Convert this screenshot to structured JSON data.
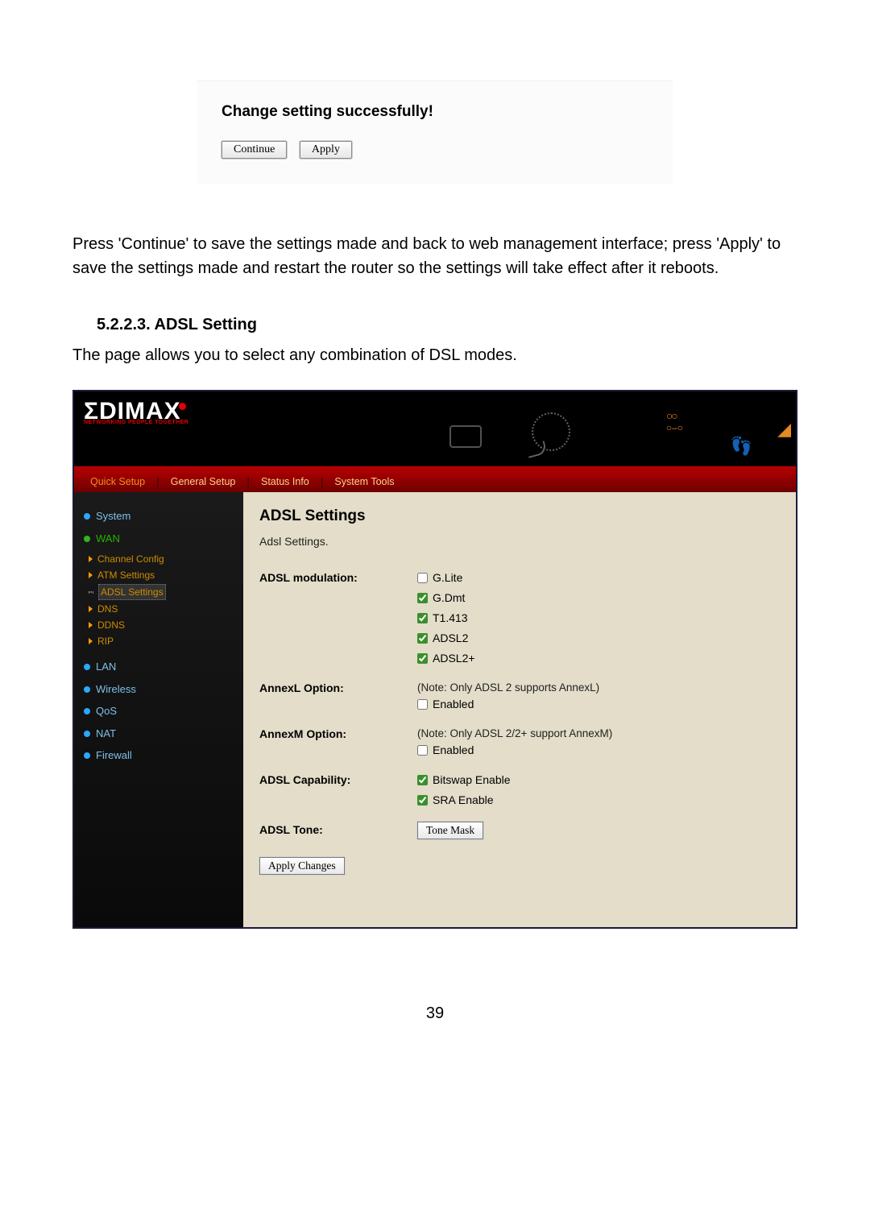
{
  "dialog": {
    "title": "Change setting successfully!",
    "continue": "Continue",
    "apply": "Apply"
  },
  "body_text": {
    "para1": "Press 'Continue' to save the settings made and back to web management interface; press 'Apply' to save the settings made and restart the router so the settings will take effect after it reboots.",
    "section_heading": "5.2.2.3. ADSL Setting",
    "para2": "The page allows you to select any combination of DSL modes."
  },
  "logo": {
    "brand": "EDIMAX",
    "tagline": "NETWORKING PEOPLE TOGETHER"
  },
  "tabs": [
    "Quick Setup",
    "General Setup",
    "Status Info",
    "System Tools"
  ],
  "sidebar": {
    "system": "System",
    "wan": "WAN",
    "wan_children": [
      "Channel Config",
      "ATM Settings",
      "ADSL Settings",
      "DNS",
      "DDNS",
      "RIP"
    ],
    "lan": "LAN",
    "wireless": "Wireless",
    "qos": "QoS",
    "nat": "NAT",
    "firewall": "Firewall"
  },
  "panel": {
    "title": "ADSL Settings",
    "subtitle": "Adsl Settings.",
    "fields": {
      "modulation_label": "ADSL modulation:",
      "mod_opts": {
        "glite": "G.Lite",
        "gdmt": "G.Dmt",
        "t1413": "T1.413",
        "adsl2": "ADSL2",
        "adsl2p": "ADSL2+"
      },
      "annexl_label": "AnnexL Option:",
      "annexl_note": "(Note: Only ADSL 2 supports AnnexL)",
      "annexm_label": "AnnexM Option:",
      "annexm_note": "(Note: Only ADSL 2/2+ support AnnexM)",
      "enabled": "Enabled",
      "capability_label": "ADSL Capability:",
      "cap_bitswap": "Bitswap Enable",
      "cap_sra": "SRA Enable",
      "tone_label": "ADSL Tone:",
      "tone_btn": "Tone Mask",
      "apply_btn": "Apply Changes"
    }
  },
  "page_number": "39"
}
